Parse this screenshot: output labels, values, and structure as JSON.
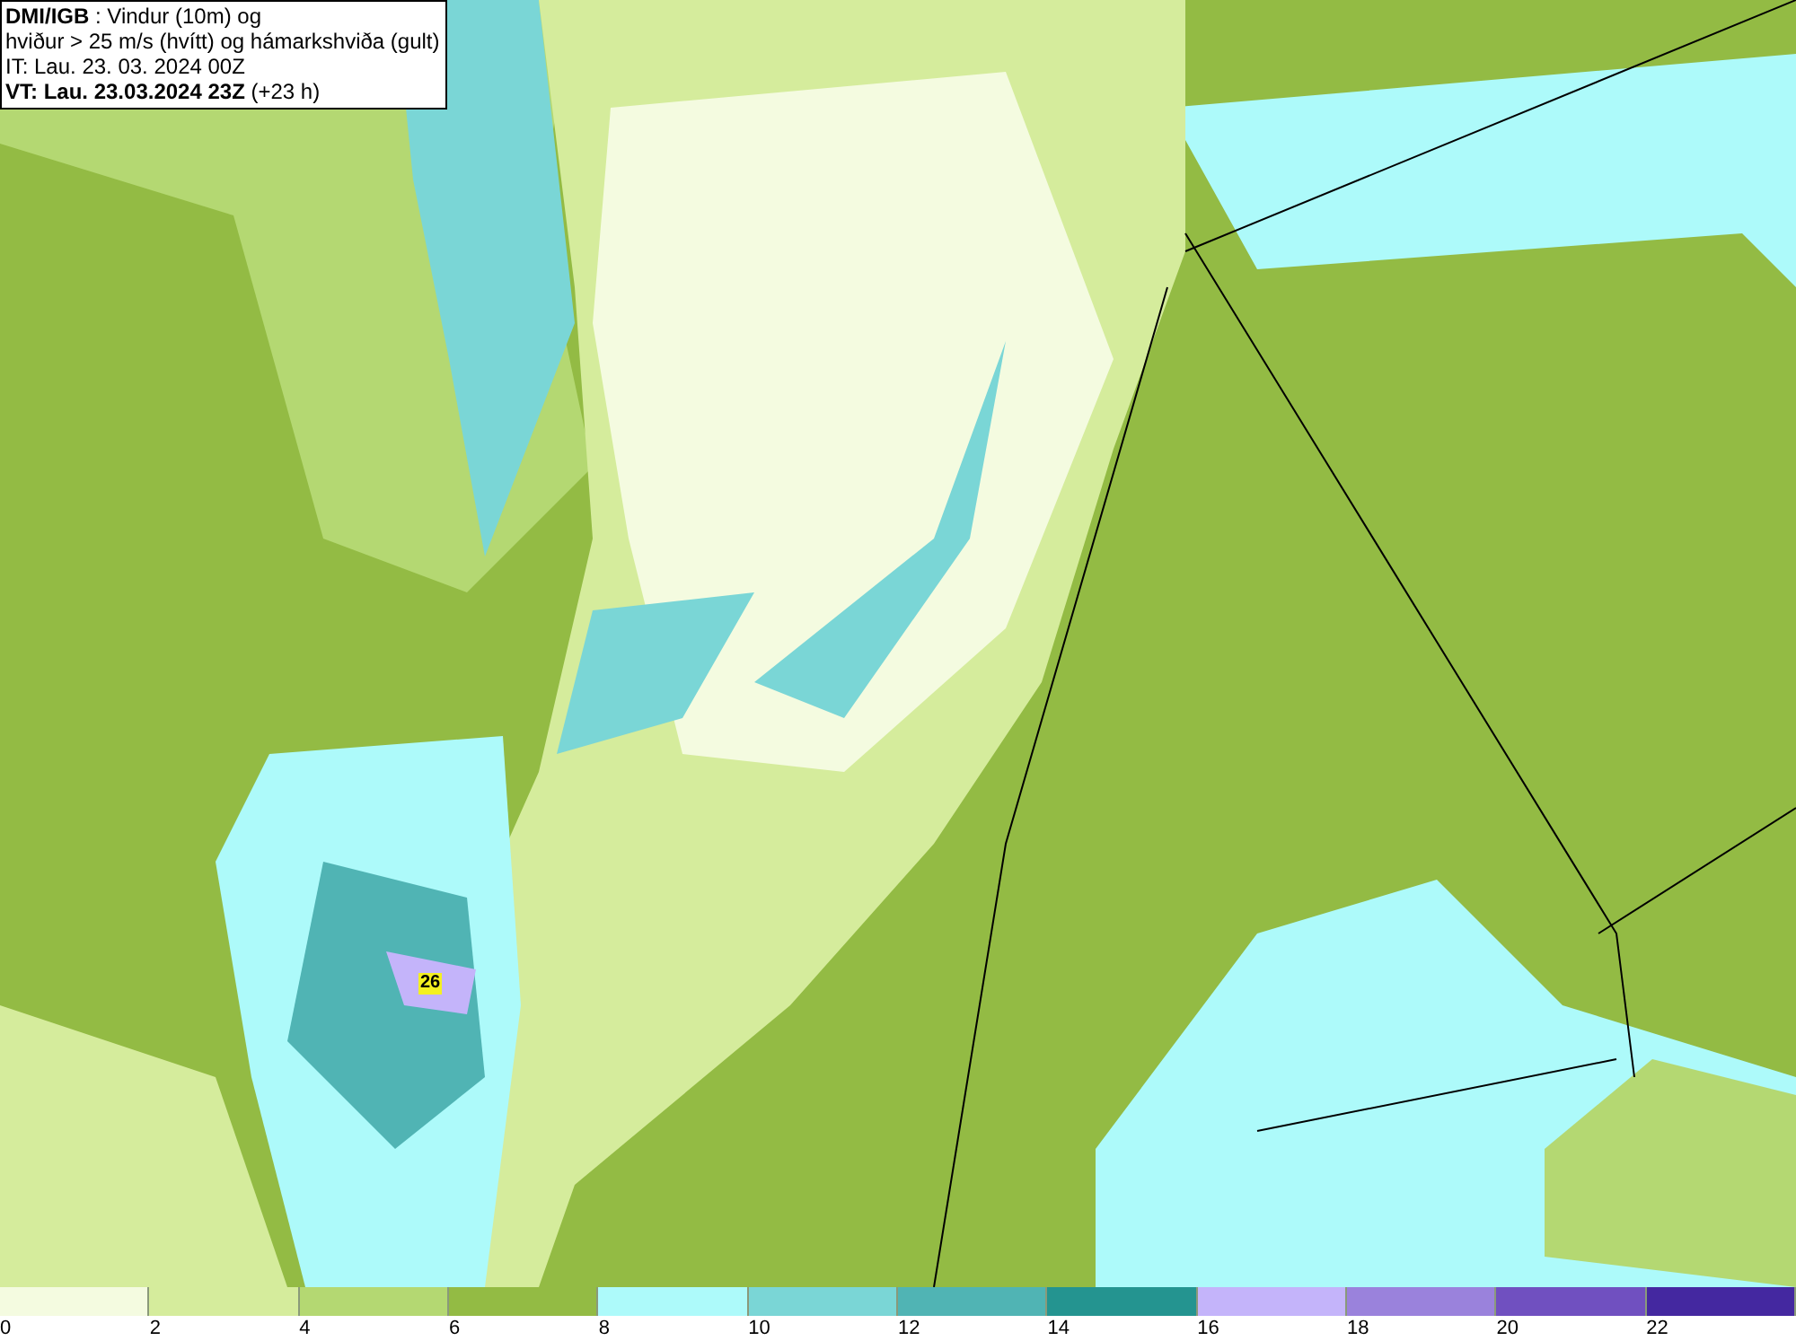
{
  "header": {
    "lines": [
      "**DMI/IGB** : Vindur (10m) og",
      "hviður > 25 m/s (hvítt) og hámarkshviða (gult)",
      "IT: Lau. 23. 03. 2024 00Z",
      "**VT: Lau. 23.03.2024 23Z** (+23 h)"
    ]
  },
  "map": {
    "gust_marker": "26"
  },
  "legend": {
    "bins": [
      {
        "label": "0",
        "color": "#f4fbe0"
      },
      {
        "label": "2",
        "color": "#d5ec9c"
      },
      {
        "label": "4",
        "color": "#b4d872"
      },
      {
        "label": "6",
        "color": "#93bb44"
      },
      {
        "label": "8",
        "color": "#adfafa"
      },
      {
        "label": "10",
        "color": "#7ad6d6"
      },
      {
        "label": "12",
        "color": "#50b4b4"
      },
      {
        "label": "14",
        "color": "#249490"
      },
      {
        "label": "16",
        "color": "#c4b4fa"
      },
      {
        "label": "18",
        "color": "#9a82dc"
      },
      {
        "label": "20",
        "color": "#7050c0"
      },
      {
        "label": "22",
        "color": "#4428a0"
      }
    ]
  }
}
